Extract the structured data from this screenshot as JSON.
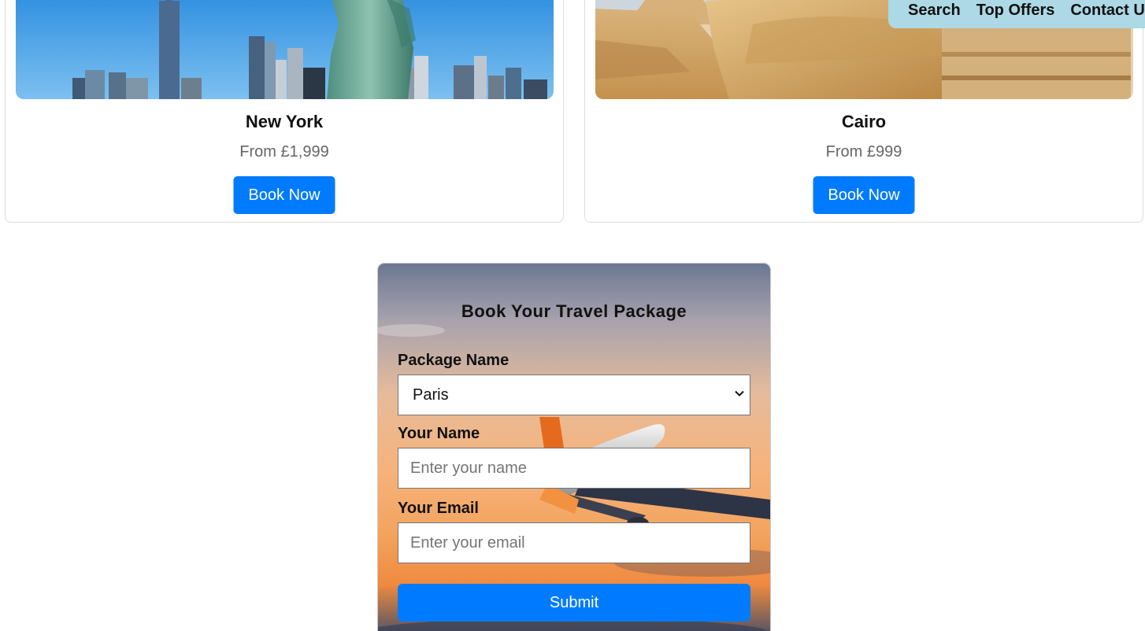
{
  "nav": {
    "items": [
      {
        "label": "Search"
      },
      {
        "label": "Top Offers"
      },
      {
        "label": "Contact Us"
      }
    ],
    "background": "#add8e6"
  },
  "destinations": [
    {
      "name": "New York",
      "price": "From £1,999",
      "button": "Book Now",
      "image": "new-york-skyline-statue-of-liberty"
    },
    {
      "name": "Cairo",
      "price": "From £999",
      "button": "Book Now",
      "image": "cairo-sphinx-pyramids"
    }
  ],
  "booking_form": {
    "title": "Book Your Travel Package",
    "package_label": "Package Name",
    "package_selected": "Paris",
    "name_label": "Your Name",
    "name_placeholder": "Enter your name",
    "email_label": "Your Email",
    "email_placeholder": "Enter your email",
    "submit_label": "Submit",
    "background_image": "airplane-sunset-sky"
  },
  "colors": {
    "accent": "#007bff",
    "price_text": "#666666"
  }
}
